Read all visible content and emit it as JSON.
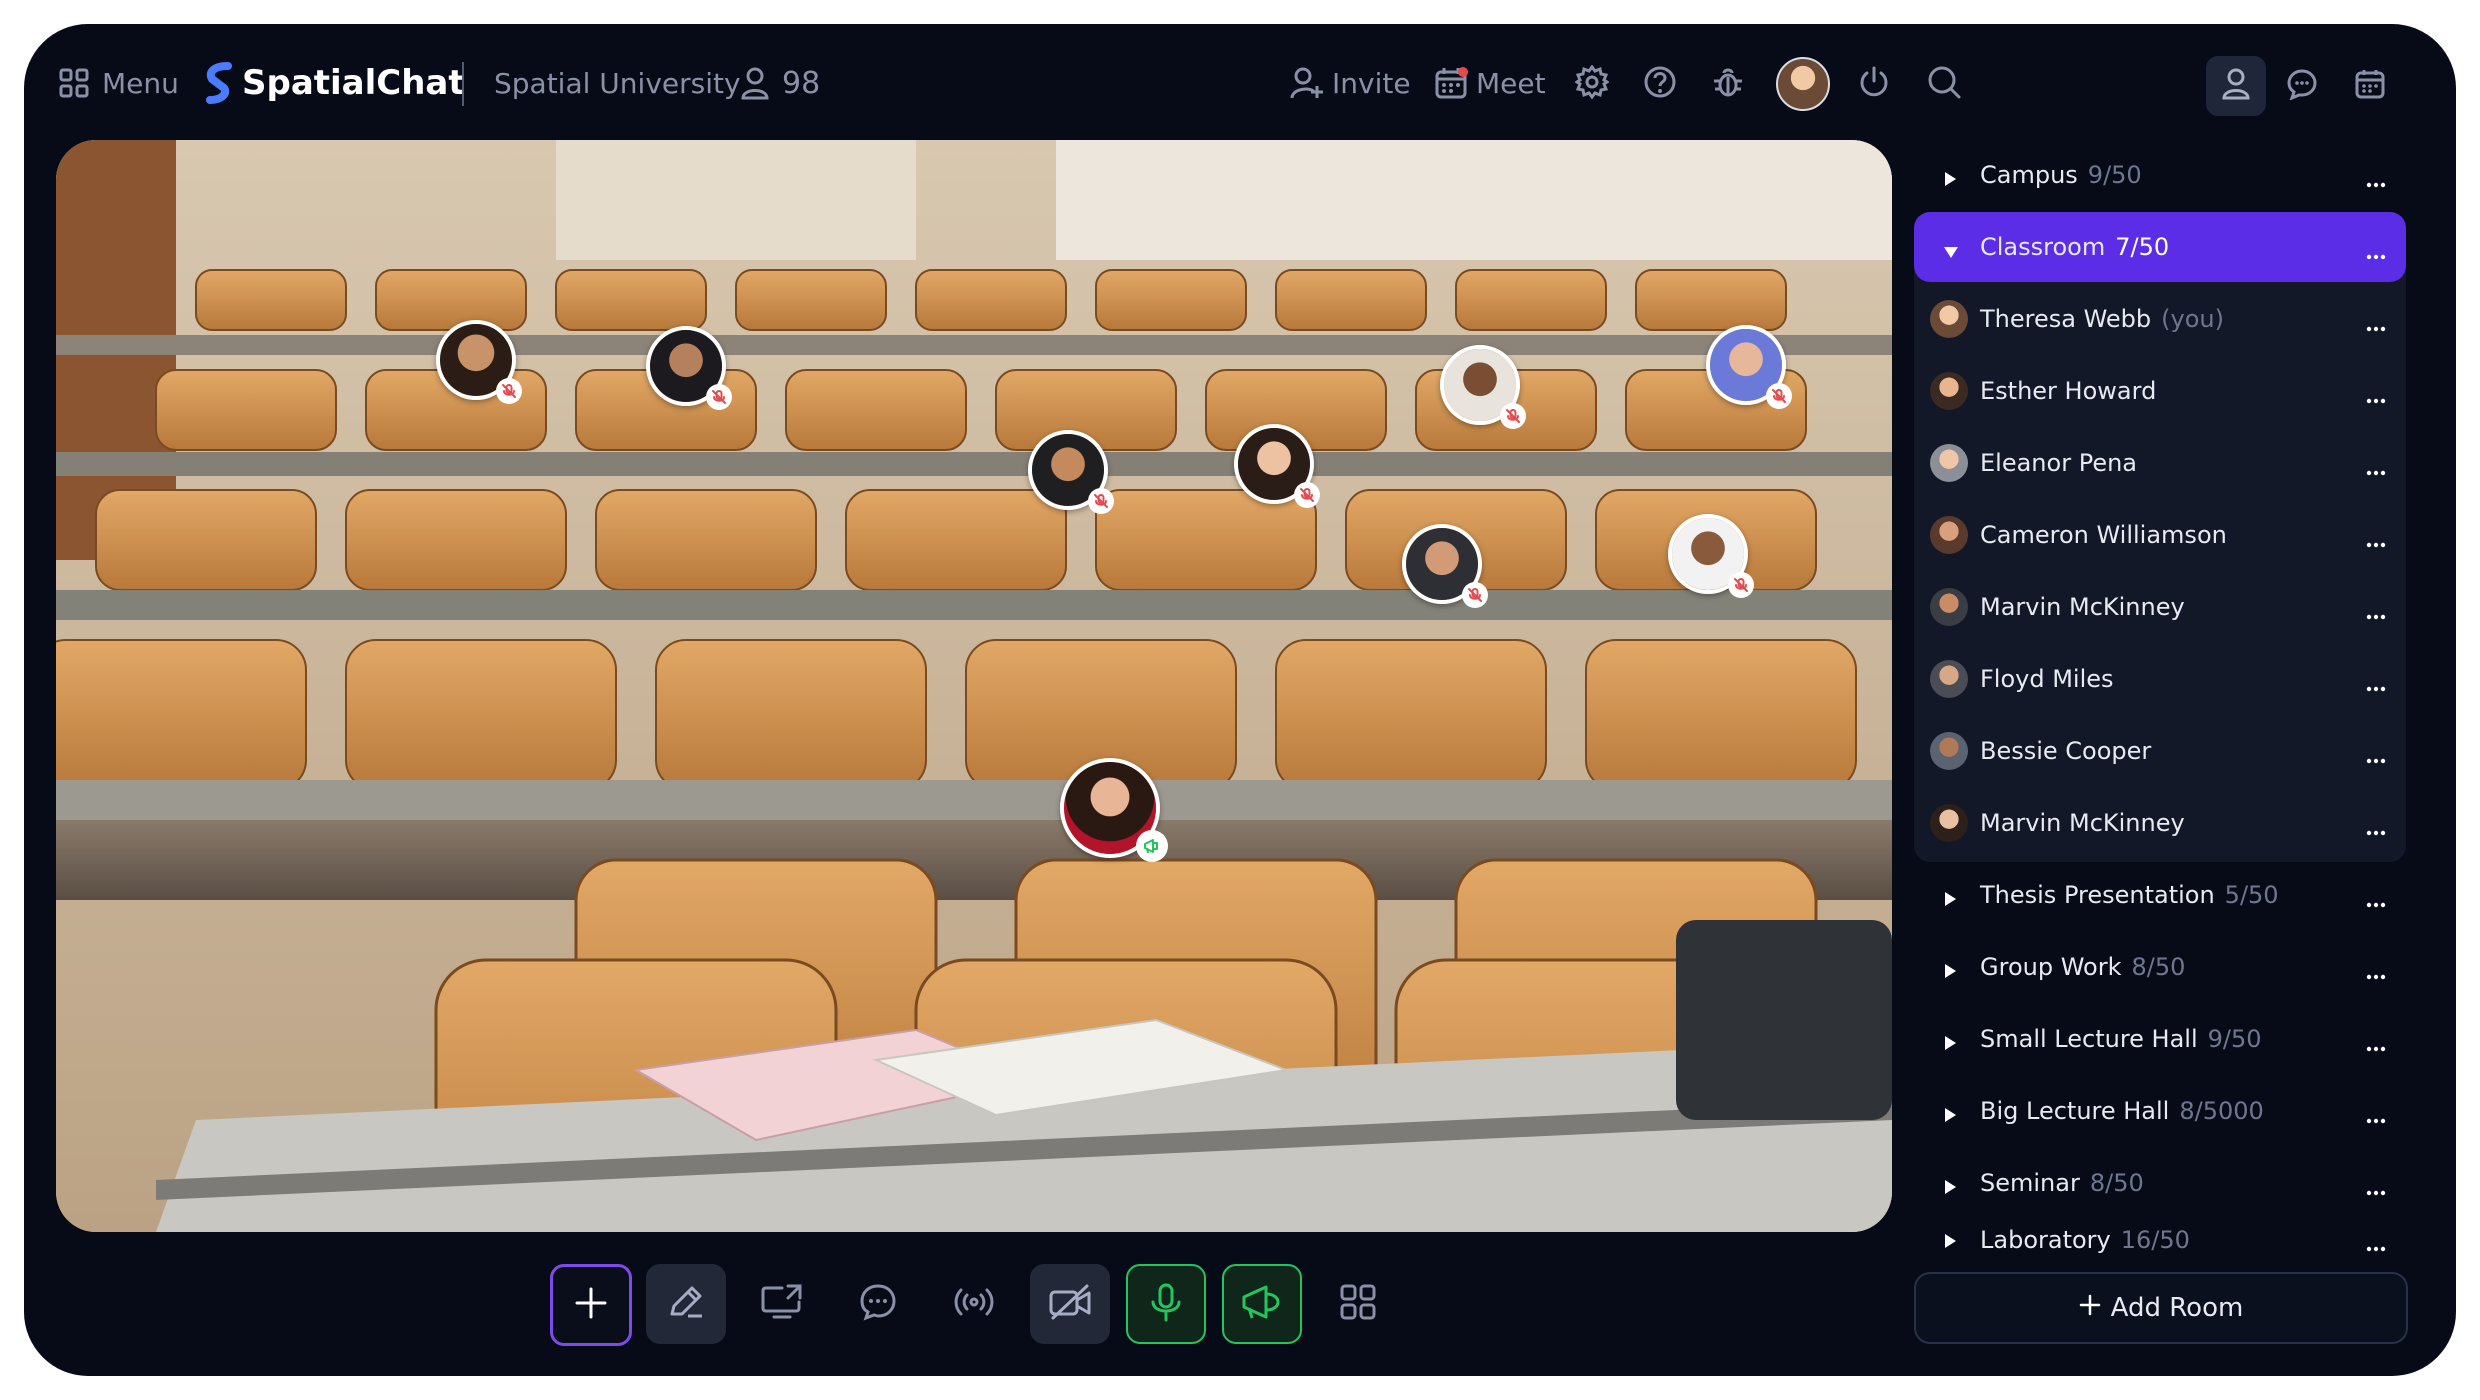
{
  "topbar": {
    "menu_label": "Menu",
    "brand": "SpatialChat",
    "space_name": "Spatial University",
    "participants_count": "98",
    "invite_label": "Invite",
    "meet_label": "Meet"
  },
  "rooms": [
    {
      "name": "Campus",
      "capacity": "9/50",
      "expanded": false
    },
    {
      "name": "Classroom",
      "capacity": "7/50",
      "expanded": true,
      "active": true
    },
    {
      "name": "Thesis Presentation",
      "capacity": "5/50",
      "expanded": false
    },
    {
      "name": "Group Work",
      "capacity": "8/50",
      "expanded": false
    },
    {
      "name": "Small Lecture Hall",
      "capacity": "9/50",
      "expanded": false
    },
    {
      "name": "Big Lecture Hall",
      "capacity": "8/5000",
      "expanded": false
    },
    {
      "name": "Seminar",
      "capacity": "8/50",
      "expanded": false
    },
    {
      "name": "Laboratory",
      "capacity": "16/50",
      "expanded": false
    }
  ],
  "classroom_members": [
    {
      "name": "Theresa Webb",
      "suffix": "(you)"
    },
    {
      "name": "Esther Howard",
      "suffix": ""
    },
    {
      "name": "Eleanor Pena",
      "suffix": ""
    },
    {
      "name": "Cameron Williamson",
      "suffix": ""
    },
    {
      "name": "Marvin McKinney",
      "suffix": ""
    },
    {
      "name": "Floyd Miles",
      "suffix": ""
    },
    {
      "name": "Bessie Cooper",
      "suffix": ""
    },
    {
      "name": "Marvin McKinney",
      "suffix": ""
    }
  ],
  "add_room_label": "Add Room",
  "colors": {
    "background": "#070b17",
    "accent": "#5b2de6",
    "mic_green": "#22c55e",
    "muted_red": "#e5484d"
  },
  "toolbar_icons": [
    "plus-icon",
    "pencil-icon",
    "screen-share-icon",
    "chat-icon",
    "broadcast-icon",
    "camera-off-icon",
    "microphone-icon",
    "megaphone-icon",
    "grid-icon"
  ]
}
